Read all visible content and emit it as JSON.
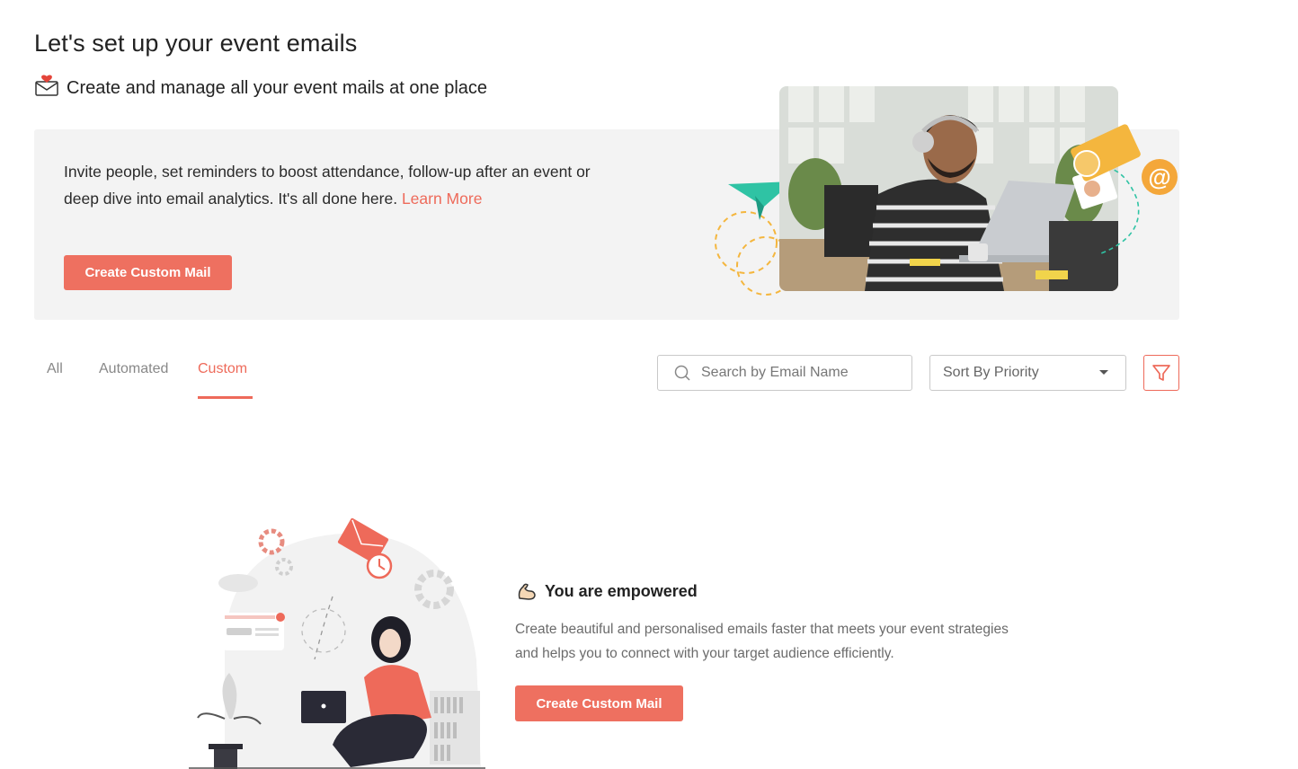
{
  "header": {
    "title": "Let's set up your event emails",
    "subtitle": "Create and manage all your event mails at one place"
  },
  "banner": {
    "description": "Invite people, set reminders to boost attendance, follow-up after an event or deep dive into email analytics. It's all done here.",
    "learn_more": "Learn More",
    "cta_label": "Create Custom Mail"
  },
  "tabs": [
    {
      "label": "All",
      "active": false
    },
    {
      "label": "Automated",
      "active": false
    },
    {
      "label": "Custom",
      "active": true
    }
  ],
  "search": {
    "placeholder": "Search by Email Name",
    "value": ""
  },
  "sort": {
    "selected": "Sort By Priority"
  },
  "icons": {
    "subtitle": "envelope-heart-icon",
    "search": "search-icon",
    "sort": "caret-down-icon",
    "filter": "filter-icon",
    "empty_title": "flexed-arm-icon"
  },
  "empty_state": {
    "title": "You are empowered",
    "description": "Create beautiful and personalised emails faster that meets your event strategies and helps you to connect with your target audience efficiently.",
    "cta_label": "Create Custom Mail"
  },
  "colors": {
    "accent": "#ee7060",
    "banner_bg": "#f3f3f3",
    "text_muted": "#6b6b6b"
  }
}
